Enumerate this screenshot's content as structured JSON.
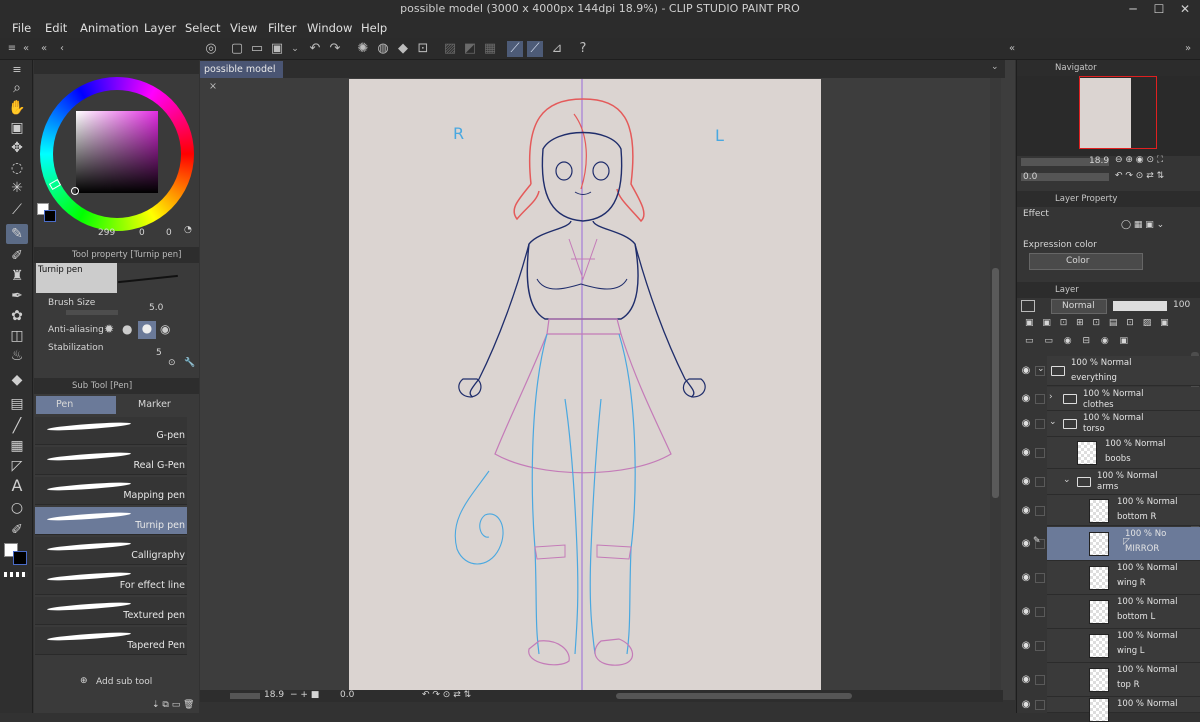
{
  "window": {
    "title": "possible model (3000 x 4000px 144dpi 18.9%) - CLIP STUDIO PAINT PRO"
  },
  "menu": [
    "File",
    "Edit",
    "Animation",
    "Layer",
    "Select",
    "View",
    "Filter",
    "Window",
    "Help"
  ],
  "colors": {
    "main": "#ffffff",
    "sub": "#000000",
    "accent": "#5b6b86",
    "selection": "#6b7a99",
    "paper": "#dbd4d1"
  },
  "color_wheel": {
    "h": "299",
    "s": "0",
    "v": "0"
  },
  "tool_property": {
    "header": "Tool property [Turnip pen]",
    "tool_name": "Turnip pen",
    "brush_size_label": "Brush Size",
    "brush_size_value": "5.0",
    "anti_aliasing_label": "Anti-aliasing",
    "stabilization_label": "Stabilization",
    "stabilization_value": "5"
  },
  "sub_tool": {
    "header": "Sub Tool [Pen]",
    "tabs": [
      "Pen",
      "Marker"
    ],
    "items": [
      "G-pen",
      "Real G-Pen",
      "Mapping pen",
      "Turnip pen",
      "Calligraphy",
      "For effect line",
      "Textured pen",
      "Tapered Pen"
    ],
    "add_label": "Add sub tool"
  },
  "document": {
    "tab": "possible model",
    "close": "×"
  },
  "canvas_notes": {
    "r": "R",
    "l": "L"
  },
  "status": {
    "zoom": "18.9",
    "angle": "0.0"
  },
  "navigator": {
    "title": "Navigator",
    "zoom": "18.9",
    "angle": "0.0"
  },
  "layer_property": {
    "title": "Layer Property",
    "effect_label": "Effect",
    "expression_label": "Expression color",
    "expression_value": "Color"
  },
  "layer_panel": {
    "title": "Layer",
    "blend": "Normal",
    "opacity": "100",
    "layers": [
      {
        "l1": "100 % Normal",
        "l2": "everything"
      },
      {
        "l1": "100 % Normal",
        "l2": "clothes"
      },
      {
        "l1": "100 % Normal",
        "l2": "torso"
      },
      {
        "l1": "100 % Normal",
        "l2": "boobs"
      },
      {
        "l1": "100 % Normal",
        "l2": "arms"
      },
      {
        "l1": "100 % Normal",
        "l2": "bottom R"
      },
      {
        "l1": "100 % No",
        "l2": "MIRROR"
      },
      {
        "l1": "100 % Normal",
        "l2": "wing R"
      },
      {
        "l1": "100 % Normal",
        "l2": "bottom L"
      },
      {
        "l1": "100 % Normal",
        "l2": "wing L"
      },
      {
        "l1": "100 % Normal",
        "l2": "top R"
      },
      {
        "l1": "100 % Normal",
        "l2": ""
      }
    ]
  }
}
